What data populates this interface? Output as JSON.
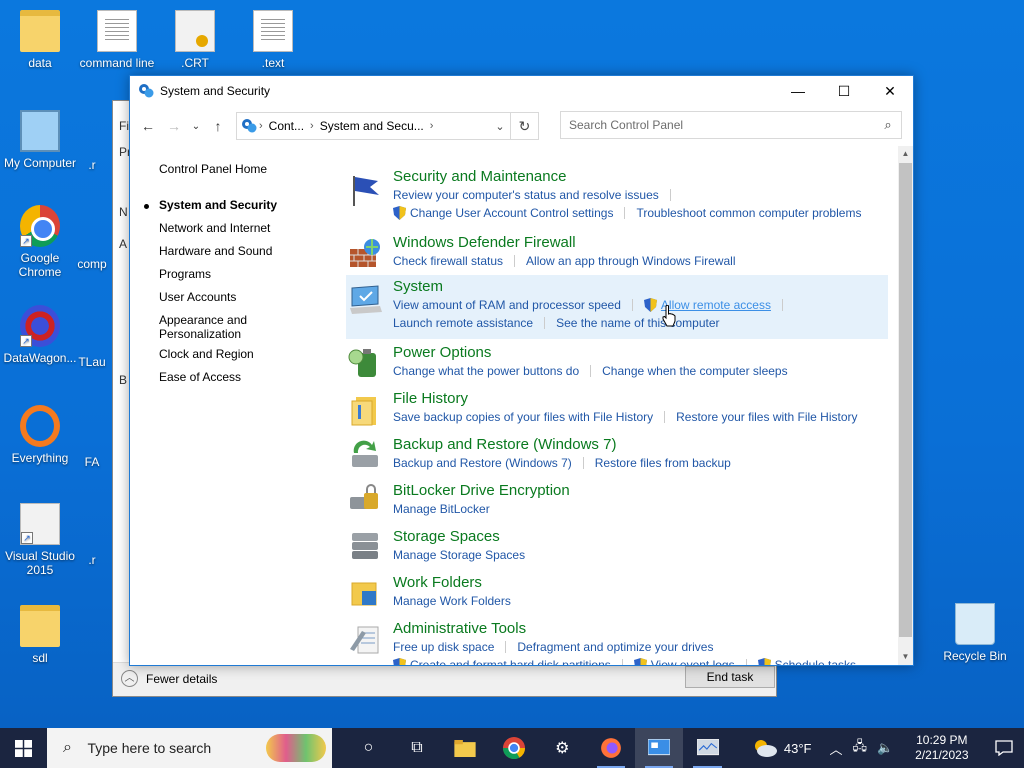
{
  "desktop": {
    "icons": [
      {
        "label": "data"
      },
      {
        "label": "command line"
      },
      {
        "label": ".CRT"
      },
      {
        "label": ".text"
      },
      {
        "label": "My Computer"
      },
      {
        "label": "Google Chrome"
      },
      {
        "label": "DataWagon..."
      },
      {
        "label": "Everything"
      },
      {
        "label": "Visual Studio 2015"
      },
      {
        "label": "sdl"
      },
      {
        "label": "Recycle Bin"
      }
    ],
    "partial_labels": [
      ".r",
      "comp",
      "TLau",
      "FA",
      ".r"
    ]
  },
  "background_window": {
    "fewer_details": "Fewer details",
    "end_task": "End task",
    "side_fragments": [
      "Fi",
      "Pr",
      "N",
      "A",
      "B"
    ]
  },
  "window": {
    "title": "System and Security",
    "icons": {
      "app": "control-panel-icon"
    },
    "address": {
      "crumbs": [
        "Cont...",
        "System and Secu..."
      ],
      "search_placeholder": "Search Control Panel"
    },
    "leftnav": {
      "home": "Control Panel Home",
      "items": [
        {
          "label": "System and Security"
        },
        {
          "label": "Network and Internet"
        },
        {
          "label": "Hardware and Sound"
        },
        {
          "label": "Programs"
        },
        {
          "label": "User Accounts"
        },
        {
          "label": "Appearance and Personalization"
        },
        {
          "label": "Clock and Region"
        },
        {
          "label": "Ease of Access"
        }
      ]
    },
    "categories": [
      {
        "title": "Security and Maintenance",
        "links1": [
          "Review your computer's status and resolve issues"
        ],
        "links2": [
          "Change User Account Control settings",
          "Troubleshoot common computer problems"
        ]
      },
      {
        "title": "Windows Defender Firewall",
        "links1": [
          "Check firewall status",
          "Allow an app through Windows Firewall"
        ]
      },
      {
        "title": "System",
        "links1": [
          "View amount of RAM and processor speed",
          "Allow remote access"
        ],
        "links2": [
          "Launch remote assistance",
          "See the name of this computer"
        ]
      },
      {
        "title": "Power Options",
        "links1": [
          "Change what the power buttons do",
          "Change when the computer sleeps"
        ]
      },
      {
        "title": "File History",
        "links1": [
          "Save backup copies of your files with File History",
          "Restore your files with File History"
        ]
      },
      {
        "title": "Backup and Restore (Windows 7)",
        "links1": [
          "Backup and Restore (Windows 7)",
          "Restore files from backup"
        ]
      },
      {
        "title": "BitLocker Drive Encryption",
        "links1": [
          "Manage BitLocker"
        ]
      },
      {
        "title": "Storage Spaces",
        "links1": [
          "Manage Storage Spaces"
        ]
      },
      {
        "title": "Work Folders",
        "links1": [
          "Manage Work Folders"
        ]
      },
      {
        "title": "Administrative Tools",
        "links1": [
          "Free up disk space",
          "Defragment and optimize your drives"
        ],
        "links2": [
          "Create and format hard disk partitions",
          "View event logs",
          "Schedule tasks"
        ]
      }
    ]
  },
  "taskbar": {
    "search_placeholder": "Type here to search",
    "weather": "43°F",
    "time": "10:29 PM",
    "date": "2/21/2023"
  },
  "colors": {
    "category_title": "#0a7a1f",
    "link": "#2157a7",
    "desktop": "#0a6fd6",
    "taskbar": "#1b2540"
  }
}
